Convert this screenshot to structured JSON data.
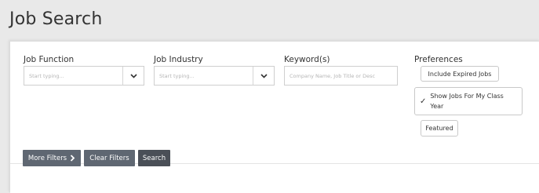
{
  "page": {
    "title": "Job Search"
  },
  "filters": {
    "job_function": {
      "label": "Job Function",
      "placeholder": "Start typing..."
    },
    "job_industry": {
      "label": "Job Industry",
      "placeholder": "Start typing..."
    },
    "keywords": {
      "label": "Keyword(s)",
      "placeholder": "Company Name, Job Title or Desc"
    },
    "preferences": {
      "label": "Preferences",
      "include_expired": "Include Expired Jobs",
      "class_year_line1": "Show Jobs For My Class",
      "class_year_line2": "Year",
      "class_year_checked": true,
      "featured": "Featured"
    }
  },
  "actions": {
    "more_filters": "More Filters",
    "clear_filters": "Clear Filters",
    "search": "Search"
  }
}
